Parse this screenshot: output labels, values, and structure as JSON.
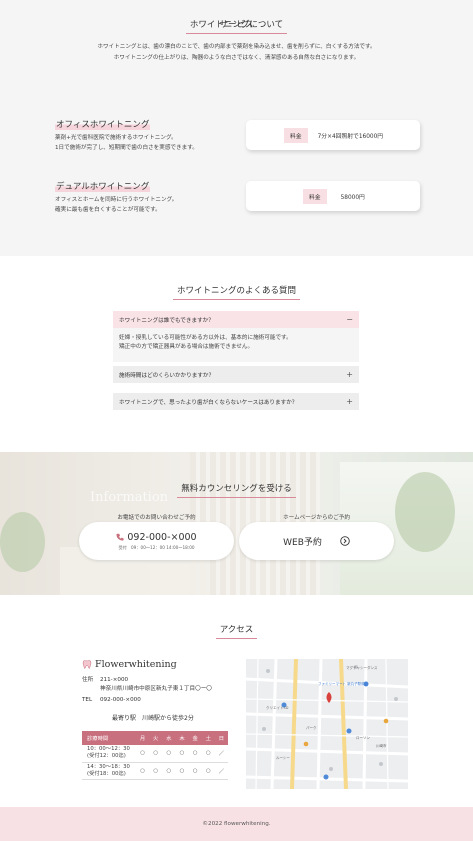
{
  "about": {
    "title": "ホワイトニングについて",
    "desc1": "ホワイトニングとは、歯の漂白のことで、歯の内部まで薬剤を染み込ませ、歯を削らずに、白くする方法です。",
    "desc2": "ホワイトニングの仕上がりは、陶器のような白さではなく、清潔感のある自然な白さになります。"
  },
  "service": {
    "title": "サービス",
    "items": [
      {
        "name": "オフィスホワイトニング",
        "line1": "薬剤+光で歯科医院で施術するホワイトニング。",
        "line2": "1日で施術が完了し、短期間で歯の白さを実感できます。",
        "price_label": "料金",
        "price": "7分×4回照射で16000円"
      },
      {
        "name": "デュアルホワイトニング",
        "line1": "オフィスとホームを同時に行うホワイトニング。",
        "line2": "確実に最も歯を白くすることが可能です。",
        "price_label": "料金",
        "price": "58000円"
      }
    ]
  },
  "faq": {
    "title": "ホワイトニングのよくある質問",
    "items": [
      {
        "q": "ホワイトニングは誰でもできますか？",
        "a1": "妊婦・授乳している可能性がある方以外は、基本的に施術可能です。",
        "a2": "矯正中の方で矯正器具がある場合は施術できません。",
        "toggle": "−"
      },
      {
        "q": "施術時間はどのくらいかかりますか？",
        "toggle": "+"
      },
      {
        "q": "ホワイトニングで、思ったより歯が白くならないケースはありますか？",
        "toggle": "+"
      }
    ]
  },
  "counsel": {
    "title": "無料カウンセリングを受ける",
    "bg_sign": "Information",
    "phone_label": "お電話でのお問い合わせご予約",
    "phone": "092-000-×000",
    "phone_hours": "受付　09：00〜12：00 14:00〜18:00",
    "web_label": "ホームページからのご予約",
    "web_button": "WEB予約"
  },
  "access": {
    "title": "アクセス",
    "logo": "Flowerwhitening",
    "addr_label": "住所",
    "zip": "211-×000",
    "address": "神奈川県川崎市中原区新丸子東１丁目〇ー〇",
    "tel_label": "TEL",
    "tel": "092-000-×000",
    "station": "最寄り駅　川崎駅から徒歩2分",
    "schedule": {
      "headers": [
        "診療時間",
        "月",
        "火",
        "水",
        "木",
        "金",
        "土",
        "日"
      ],
      "rows": [
        {
          "time1": "10：00〜12：30",
          "time2": "(受付12：00迄)",
          "marks": [
            "○",
            "○",
            "○",
            "○",
            "○",
            "○",
            "／"
          ]
        },
        {
          "time1": "14：30〜18：30",
          "time2": "(受付18：00迄)",
          "marks": [
            "○",
            "○",
            "○",
            "○",
            "○",
            "○",
            "／"
          ]
        }
      ]
    },
    "map_labels": [
      "マグチャシーダンス",
      "ファミリーマート 新丸子駅前店",
      "クリエイトSD",
      "ローソン",
      "ルーシー",
      "川崎市",
      "パーク"
    ]
  },
  "footer": {
    "copyright": "©2022 flowerwhitening."
  }
}
